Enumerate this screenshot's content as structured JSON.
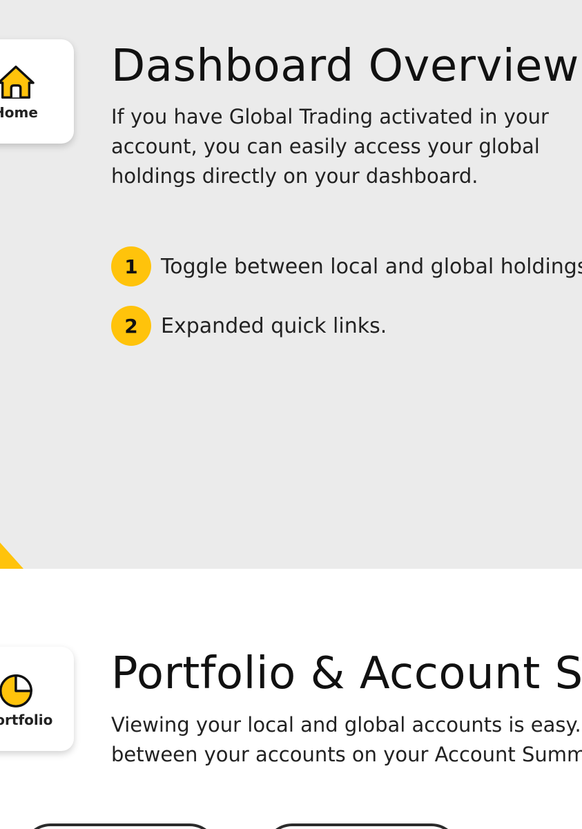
{
  "colors": {
    "accent": "#ffc30b",
    "section_background": "#ebebeb",
    "page_background": "#ffffff"
  },
  "dashboard_section": {
    "nav_card": {
      "label": "Home",
      "icon": "home-icon"
    },
    "title": "Dashboard Overview",
    "description_lines": [
      "If you have Global Trading activated in your",
      "account, you can easily access your global",
      "holdings directly on your dashboard."
    ],
    "steps": [
      {
        "number": "1",
        "text": "Toggle between local and global holdings."
      },
      {
        "number": "2",
        "text": "Expanded quick links."
      }
    ]
  },
  "portfolio_section": {
    "nav_card": {
      "label": "Portfolio",
      "icon": "pie-chart-icon"
    },
    "title": "Portfolio & Account Summary",
    "description_lines": [
      "Viewing your local and global accounts is easy.",
      "between your accounts on your Account Summary"
    ]
  }
}
